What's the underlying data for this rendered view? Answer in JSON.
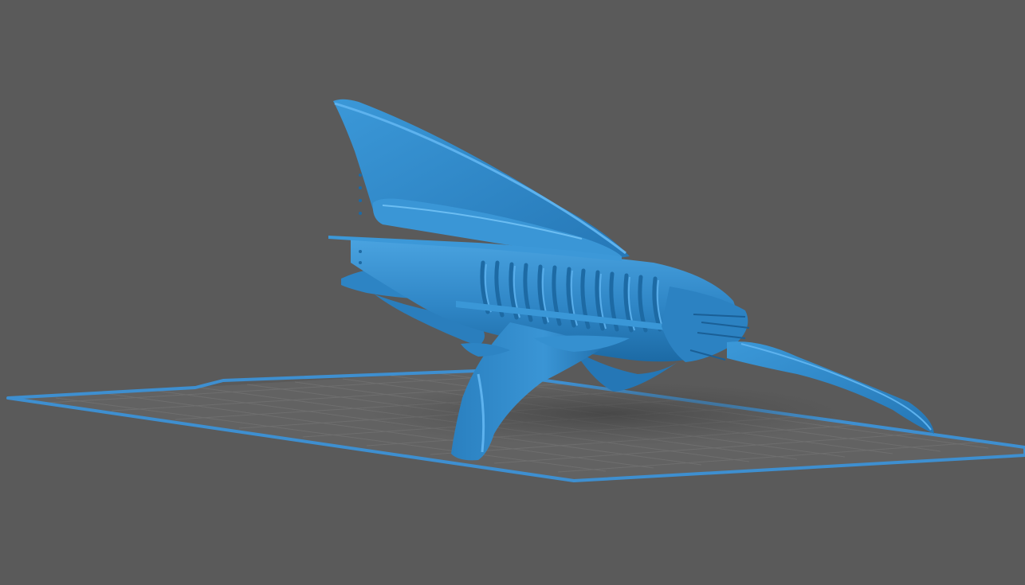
{
  "viewport": {
    "background_color": "#5a5a5a",
    "model_color": "#2f86c6",
    "model_highlight_color": "#5fb0ea",
    "model_shadow_color": "#1b5f92",
    "bed_outline_color": "#3e8fd0",
    "bed_fill_color": "#626262",
    "grid_color": "#6c6c6c",
    "object_name": "model-mesh"
  }
}
